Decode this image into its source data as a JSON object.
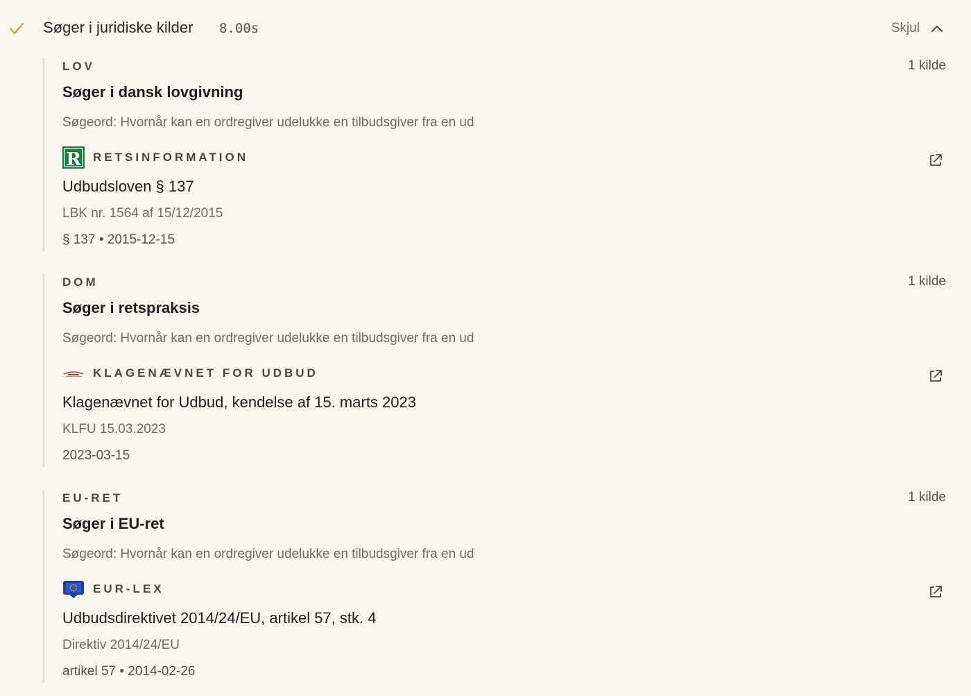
{
  "header": {
    "title": "Søger i juridiske kilder",
    "time": "8.00s",
    "hide_label": "Skjul",
    "check_color": "#c9a83a"
  },
  "sections": [
    {
      "category": "LOV",
      "count": "1 kilde",
      "title": "Søger i dansk lovgivning",
      "query": "Søgeord: Hvornår kan en ordregiver udelukke en tilbudsgiver fra en ud",
      "source": {
        "name": "RETSINFORMATION",
        "icon": "retsinformation-logo",
        "color": "#1b7a3e"
      },
      "doc_title": "Udbudsloven § 137",
      "doc_ref": "LBK nr. 1564 af 15/12/2015",
      "doc_meta": "§ 137 • 2015-12-15"
    },
    {
      "category": "DOM",
      "count": "1 kilde",
      "title": "Søger i retspraksis",
      "query": "Søgeord: Hvornår kan en ordregiver udelukke en tilbudsgiver fra en ud",
      "source": {
        "name": "KLAGENÆVNET FOR UDBUD",
        "icon": "klagenaevnet-logo",
        "color": "#c0392b"
      },
      "doc_title": "Klagenævnet for Udbud, kendelse af 15. marts 2023",
      "doc_ref": "KLFU 15.03.2023",
      "doc_meta": "2023-03-15"
    },
    {
      "category": "EU-RET",
      "count": "1 kilde",
      "title": "Søger i EU-ret",
      "query": "Søgeord: Hvornår kan en ordregiver udelukke en tilbudsgiver fra en ud",
      "source": {
        "name": "EUR-LEX",
        "icon": "eur-lex-logo",
        "color": "#1f3f9a"
      },
      "doc_title": "Udbudsdirektivet 2014/24/EU, artikel 57, stk. 4",
      "doc_ref": "Direktiv 2014/24/EU",
      "doc_meta": "artikel 57 • 2014-02-26"
    }
  ]
}
